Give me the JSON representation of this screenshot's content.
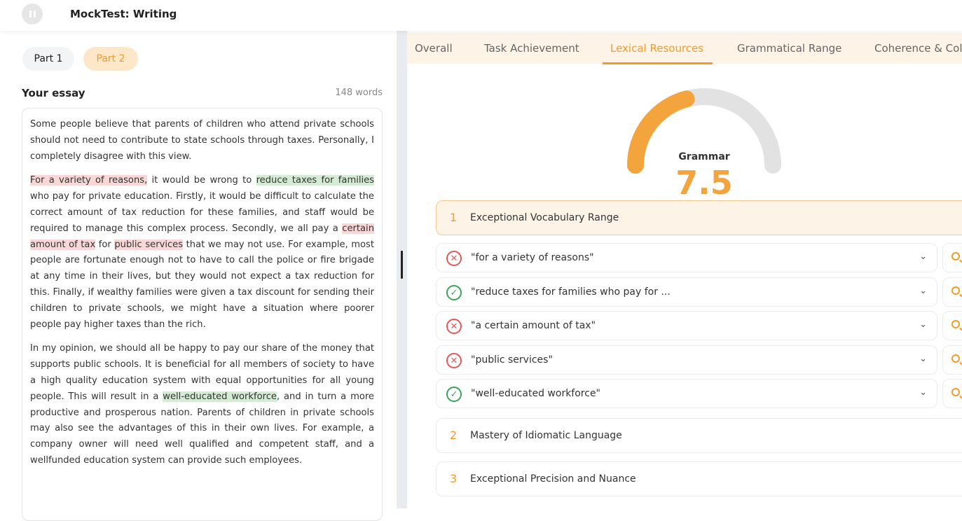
{
  "header": {
    "title": "MockTest: Writing",
    "pause_icon": "pause-icon"
  },
  "parts": [
    {
      "label": "Part 1"
    },
    {
      "label": "Part 2"
    }
  ],
  "essay": {
    "label": "Your essay",
    "word_count": "148 words",
    "p1": "Some people believe that parents of children who attend private schools should not need to contribute to state schools through taxes. Personally, I completely disagree with this view.",
    "p2": {
      "s1": "For a variety of reasons,",
      "s2": " it would be wrong to ",
      "s3": "reduce taxes for families",
      "s4": " who pay for private education. Firstly, it would be difficult to calculate the correct amount of tax reduction for these families, and staff would be required to manage this complex process. Secondly, we all pay a ",
      "s5": "certain amount of tax",
      "s6": " for ",
      "s7": "public services",
      "s8": " that we may not use. For example, most people are fortunate enough not to have to call the police or fire brigade at any time in their lives, but they would not expect a tax reduction for this. Finally, if wealthy families were given a tax discount for sending their children to private schools, we might have a situation where poorer people pay higher taxes than the rich."
    },
    "p3": {
      "s1": "In my opinion, we should all be happy to pay our share of the money that supports public schools. It is beneficial for all members of society to have a high quality education system with equal opportunities for all young people. This will result in a ",
      "s2": "well-educated workforce",
      "s3": ", and in turn a more productive and prosperous nation. Parents of children in private schools may also see the advantages of this in their own lives. For example, a company owner will need well qualified and competent staff, and a wellfunded education system can provide such employees."
    }
  },
  "tabs": [
    {
      "label": "Overall"
    },
    {
      "label": "Task Achievement"
    },
    {
      "label": "Lexical Resources"
    },
    {
      "label": "Grammatical Range"
    },
    {
      "label": "Coherence & Col"
    }
  ],
  "gauge": {
    "label": "Grammar",
    "score": "7.5",
    "score_value": 7.5,
    "max": 9,
    "accent": "#f4a43c"
  },
  "criteria": [
    {
      "num": "1",
      "title": "Exceptional Vocabulary Range",
      "state": "open"
    },
    {
      "num": "2",
      "title": "Mastery of Idiomatic Language",
      "state": "closed"
    },
    {
      "num": "3",
      "title": "Exceptional Precision and Nuance",
      "state": "closed"
    }
  ],
  "items": [
    {
      "text": "\"for a variety of reasons\"",
      "status": "bad",
      "icon": "x-circle-icon"
    },
    {
      "text": "\"reduce taxes for families who pay for ...",
      "status": "good",
      "icon": "check-circle-icon"
    },
    {
      "text": "\"a certain amount of tax\"",
      "status": "bad",
      "icon": "x-circle-icon"
    },
    {
      "text": "\"public services\"",
      "status": "bad",
      "icon": "x-circle-icon"
    },
    {
      "text": "\"well-educated workforce\"",
      "status": "good",
      "icon": "check-circle-icon"
    }
  ],
  "glyphs": {
    "bad": "✕",
    "good": "✓",
    "chev_down": "⌄",
    "chev_up": "⌃"
  },
  "colors": {
    "accent": "#f39b2a",
    "good": "#3aa35a",
    "bad": "#e45757"
  }
}
